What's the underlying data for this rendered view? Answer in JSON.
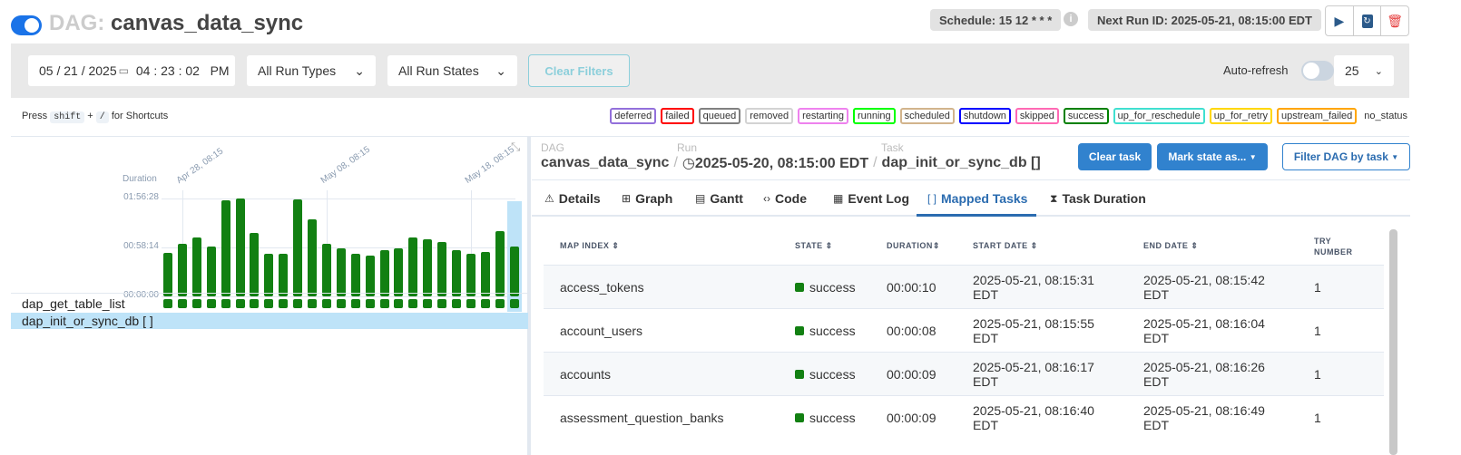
{
  "header": {
    "prefix": "DAG:",
    "dag_id": "canvas_data_sync",
    "schedule": "Schedule: 15 12 * * *",
    "next_run": "Next Run ID: 2025-05-21, 08:15:00 EDT",
    "info_icon": "i"
  },
  "filters": {
    "datetime": "05 / 21 / 2025",
    "time": "04 : 23 : 02   PM",
    "run_types": "All Run Types",
    "run_states": "All Run States",
    "clear": "Clear Filters",
    "auto_refresh": "Auto-refresh",
    "page_size": "25"
  },
  "shortcuts": {
    "press": "Press",
    "key1": "shift",
    "plus": "+",
    "key2": "/",
    "suffix": "for Shortcuts"
  },
  "legend": [
    {
      "label": "deferred",
      "color": "#9370db"
    },
    {
      "label": "failed",
      "color": "#ff0000"
    },
    {
      "label": "queued",
      "color": "#808080"
    },
    {
      "label": "removed",
      "color": "#d3d3d3"
    },
    {
      "label": "restarting",
      "color": "#ee82ee"
    },
    {
      "label": "running",
      "color": "#00ff00"
    },
    {
      "label": "scheduled",
      "color": "#d2b48c"
    },
    {
      "label": "shutdown",
      "color": "#0000ff"
    },
    {
      "label": "skipped",
      "color": "#ff69b4"
    },
    {
      "label": "success",
      "color": "#008000"
    },
    {
      "label": "up_for_reschedule",
      "color": "#40e0d0"
    },
    {
      "label": "up_for_retry",
      "color": "#ffd700"
    },
    {
      "label": "upstream_failed",
      "color": "#ffa500"
    },
    {
      "label": "no_status",
      "color": ""
    }
  ],
  "chart_data": {
    "type": "bar",
    "title": "",
    "ylabel": "Duration",
    "yticks": [
      "00:00:00",
      "00:58:14",
      "01:56:28"
    ],
    "ylim_minutes": [
      0,
      116.47
    ],
    "xticks": [
      "Apr 28, 08:15",
      "May 08, 08:15",
      "May 18, 08:15"
    ],
    "xtick_indices": [
      1,
      11,
      21
    ],
    "values_minutes": [
      52,
      63,
      70,
      59,
      114,
      116.5,
      76,
      51,
      51,
      115,
      92,
      63,
      57,
      51,
      48,
      55,
      57,
      70,
      68,
      65,
      55,
      51,
      53,
      78,
      59
    ],
    "selected_index": 24,
    "color": "#128012"
  },
  "grid_tasks": [
    {
      "name": "dap_get_table_list",
      "state": "success"
    },
    {
      "name": "dap_init_or_sync_db [ ]",
      "state": "success",
      "selected": true
    }
  ],
  "breadcrumb": {
    "dag_label": "DAG",
    "dag": "canvas_data_sync",
    "run_label": "Run",
    "run": "2025-05-20, 08:15:00 EDT",
    "task_label": "Task",
    "task": "dap_init_or_sync_db []"
  },
  "actions": {
    "clear_task": "Clear task",
    "mark_state": "Mark state as...",
    "filter": "Filter DAG by task"
  },
  "tabs": [
    {
      "label": "Details",
      "icon": "⚠"
    },
    {
      "label": "Graph",
      "icon": "⊞"
    },
    {
      "label": "Gantt",
      "icon": "▤"
    },
    {
      "label": "Code",
      "icon": "‹›"
    },
    {
      "label": "Event Log",
      "icon": "▦"
    },
    {
      "label": "Mapped Tasks",
      "icon": "[ ]",
      "active": true
    },
    {
      "label": "Task Duration",
      "icon": "⧗"
    }
  ],
  "table": {
    "headers": [
      "MAP INDEX",
      "STATE",
      "DURATION",
      "START DATE",
      "END DATE",
      "TRY NUMBER"
    ],
    "rows": [
      {
        "map_index": "access_tokens",
        "state": "success",
        "duration": "00:00:10",
        "start": "2025-05-21, 08:15:31",
        "start_tz": "EDT",
        "end": "2025-05-21, 08:15:42",
        "end_tz": "EDT",
        "try": "1"
      },
      {
        "map_index": "account_users",
        "state": "success",
        "duration": "00:00:08",
        "start": "2025-05-21, 08:15:55",
        "start_tz": "EDT",
        "end": "2025-05-21, 08:16:04",
        "end_tz": "EDT",
        "try": "1"
      },
      {
        "map_index": "accounts",
        "state": "success",
        "duration": "00:00:09",
        "start": "2025-05-21, 08:16:17",
        "start_tz": "EDT",
        "end": "2025-05-21, 08:16:26",
        "end_tz": "EDT",
        "try": "1"
      },
      {
        "map_index": "assessment_question_banks",
        "state": "success",
        "duration": "00:00:09",
        "start": "2025-05-21, 08:16:40",
        "start_tz": "EDT",
        "end": "2025-05-21, 08:16:49",
        "end_tz": "EDT",
        "try": "1"
      }
    ]
  }
}
